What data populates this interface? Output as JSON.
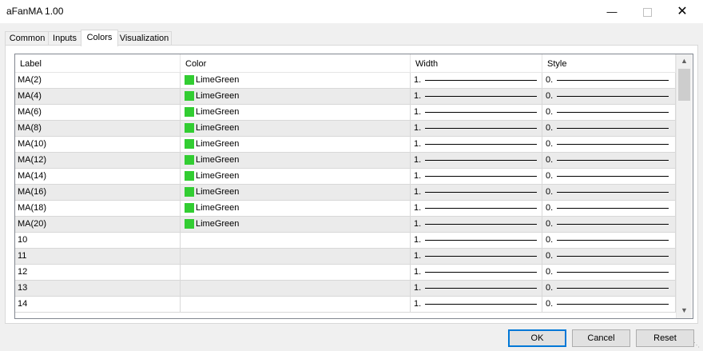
{
  "window": {
    "title": "aFanMA 1.00",
    "minimize_icon": "minimize-icon",
    "maximize_icon": "maximize-icon",
    "close_icon": "close-icon"
  },
  "tabs": [
    {
      "label": "Common",
      "active": false
    },
    {
      "label": "Inputs",
      "active": false
    },
    {
      "label": "Colors",
      "active": true
    },
    {
      "label": "Visualization",
      "active": false
    }
  ],
  "table": {
    "columns": [
      "Label",
      "Color",
      "Width",
      "Style"
    ],
    "swatch_color": "#32cd32",
    "rows": [
      {
        "label": "MA(2)",
        "color": "LimeGreen",
        "width": "1.",
        "style": "0."
      },
      {
        "label": "MA(4)",
        "color": "LimeGreen",
        "width": "1.",
        "style": "0."
      },
      {
        "label": "MA(6)",
        "color": "LimeGreen",
        "width": "1.",
        "style": "0."
      },
      {
        "label": "MA(8)",
        "color": "LimeGreen",
        "width": "1.",
        "style": "0."
      },
      {
        "label": "MA(10)",
        "color": "LimeGreen",
        "width": "1.",
        "style": "0."
      },
      {
        "label": "MA(12)",
        "color": "LimeGreen",
        "width": "1.",
        "style": "0."
      },
      {
        "label": "MA(14)",
        "color": "LimeGreen",
        "width": "1.",
        "style": "0."
      },
      {
        "label": "MA(16)",
        "color": "LimeGreen",
        "width": "1.",
        "style": "0."
      },
      {
        "label": "MA(18)",
        "color": "LimeGreen",
        "width": "1.",
        "style": "0."
      },
      {
        "label": "MA(20)",
        "color": "LimeGreen",
        "width": "1.",
        "style": "0."
      },
      {
        "label": "10",
        "color": "",
        "width": "1.",
        "style": "0."
      },
      {
        "label": "11",
        "color": "",
        "width": "1.",
        "style": "0."
      },
      {
        "label": "12",
        "color": "",
        "width": "1.",
        "style": "0."
      },
      {
        "label": "13",
        "color": "",
        "width": "1.",
        "style": "0."
      },
      {
        "label": "14",
        "color": "",
        "width": "1.",
        "style": "0."
      }
    ]
  },
  "buttons": {
    "ok": "OK",
    "cancel": "Cancel",
    "reset": "Reset"
  }
}
